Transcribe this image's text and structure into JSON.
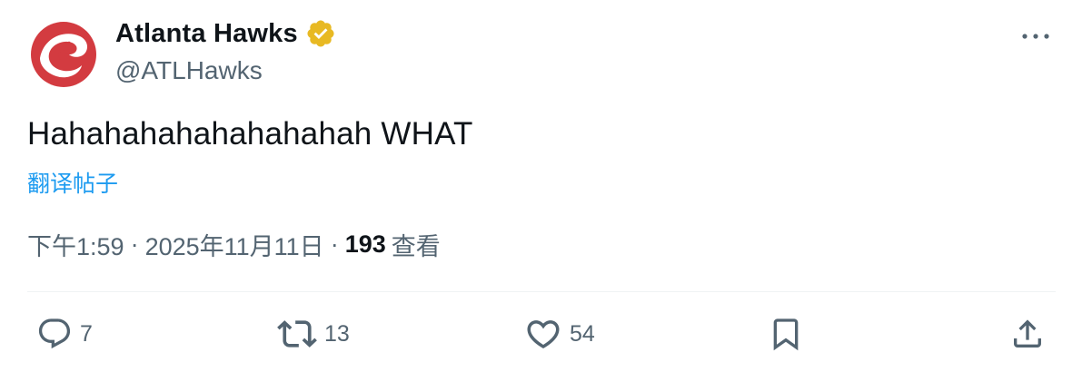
{
  "author": {
    "display_name": "Atlanta Hawks",
    "handle": "@ATLHawks",
    "verified": true,
    "verified_badge_color": "#e8b923",
    "avatar_icon": "hawk-logo-icon",
    "avatar_color": "#d33b40"
  },
  "tweet": {
    "text": "Hahahahahahahahahah WHAT",
    "translate_label": "翻译帖子"
  },
  "meta": {
    "time": "下午1:59",
    "date": "2025年11月11日",
    "separator": "·",
    "views_count": "193",
    "views_label": "查看"
  },
  "actions": {
    "reply_count": "7",
    "retweet_count": "13",
    "like_count": "54"
  },
  "colors": {
    "text": "#0f1419",
    "secondary": "#536471",
    "link": "#1d9bf0",
    "divider": "#eff3f4"
  }
}
